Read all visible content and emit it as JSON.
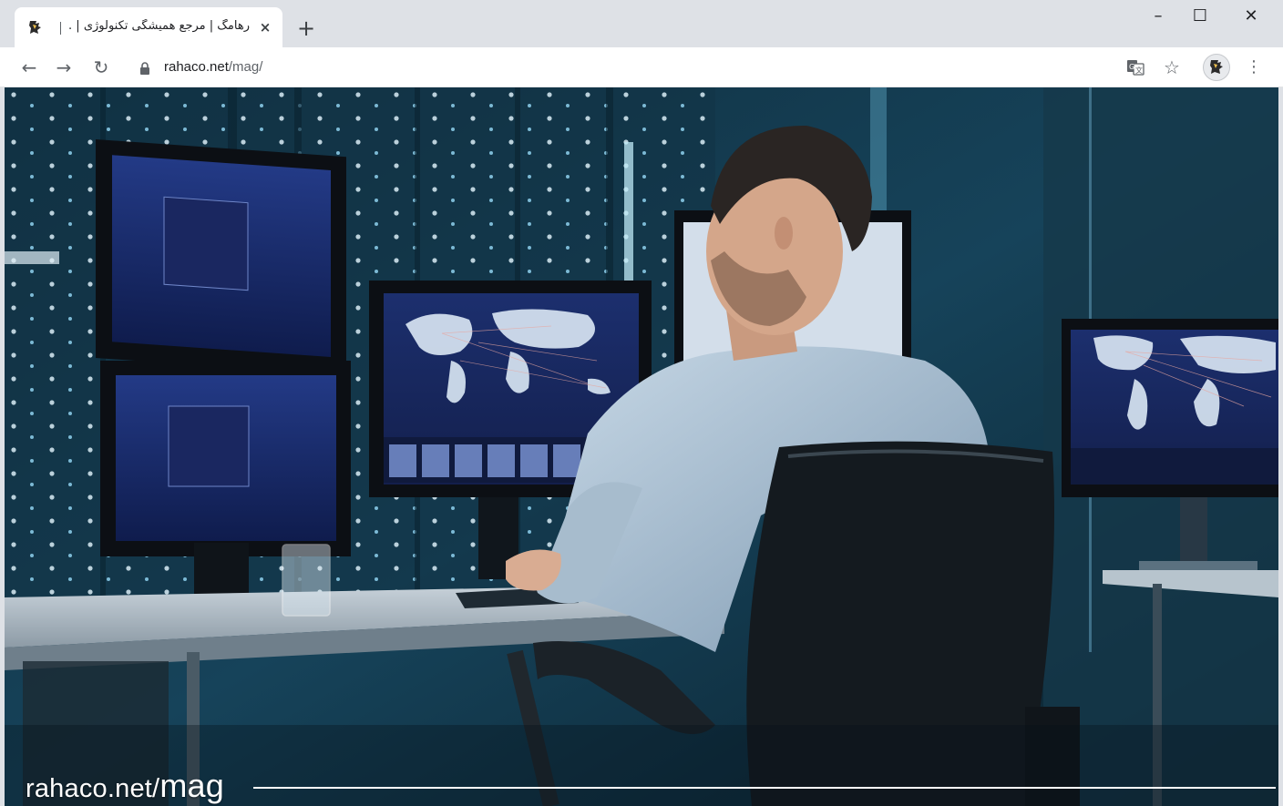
{
  "browser": {
    "tab": {
      "title": "رهامگ | مرجع همیشگی تکنولوژی | ...",
      "close_icon": "×"
    },
    "new_tab_icon": "+",
    "window_controls": {
      "minimize": "–",
      "maximize": "☐",
      "close": "✕"
    },
    "toolbar": {
      "back_icon": "←",
      "forward_icon": "→",
      "reload_icon": "↻",
      "url_host": "rahaco.net",
      "url_path": "/mag/",
      "star_icon": "☆",
      "menu_icon": "⋮"
    }
  },
  "page": {
    "watermark_host": "rahaco.net/",
    "watermark_path": "mag"
  },
  "colors": {
    "tabstrip": "#dee1e6",
    "photo_dark": "#0b2533",
    "accent_blue": "#4aa3d8"
  }
}
